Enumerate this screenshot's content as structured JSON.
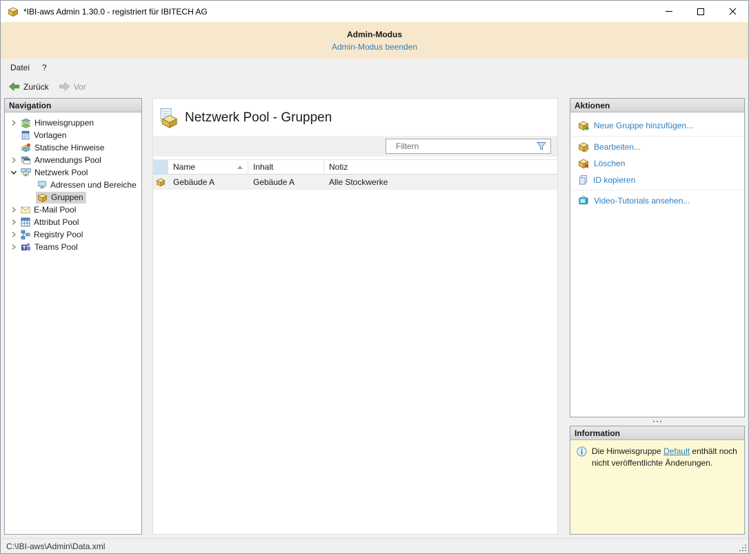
{
  "colors": {
    "accent_link": "#2e7fc2",
    "banner_bg": "#f7e7cd",
    "info_bg": "#fcf9d4",
    "selection_bg": "#d4d4d4",
    "box_gold": "#e2bb4d"
  },
  "window": {
    "title": "*IBI-aws Admin 1.30.0 - registriert für IBITECH AG"
  },
  "admin_banner": {
    "title": "Admin-Modus",
    "link": "Admin-Modus beenden"
  },
  "menu": {
    "items": [
      {
        "label": "Datei"
      },
      {
        "label": "?"
      }
    ]
  },
  "toolbar": {
    "back_label": "Zurück",
    "forward_label": "Vor"
  },
  "navigation": {
    "header": "Navigation",
    "items": [
      {
        "label": "Hinweisgruppen"
      },
      {
        "label": "Vorlagen"
      },
      {
        "label": "Statische Hinweise"
      },
      {
        "label": "Anwendungs Pool"
      },
      {
        "label": "Netzwerk Pool"
      },
      {
        "label": "Adressen und Bereiche"
      },
      {
        "label": "Gruppen"
      },
      {
        "label": "E-Mail Pool"
      },
      {
        "label": "Attribut Pool"
      },
      {
        "label": "Registry Pool"
      },
      {
        "label": "Teams Pool"
      }
    ]
  },
  "main": {
    "title": "Netzwerk Pool - Gruppen",
    "filter_placeholder": "Filtern",
    "table": {
      "columns": [
        "Name",
        "Inhalt",
        "Notiz"
      ],
      "sort_column": "Name",
      "sort_direction": "ascending",
      "rows": [
        {
          "name": "Gebäude A",
          "inhalt": "Gebäude A",
          "notiz": "Alle Stockwerke"
        }
      ]
    }
  },
  "actions": {
    "header": "Aktionen",
    "items": [
      {
        "label": "Neue Gruppe hinzufügen..."
      },
      {
        "label": "Bearbeiten..."
      },
      {
        "label": "Löschen"
      },
      {
        "label": "ID kopieren"
      },
      {
        "label": "Video-Tutorials ansehen..."
      }
    ]
  },
  "information": {
    "header": "Information",
    "text_before": "Die Hinweisgruppe ",
    "link": "Default",
    "text_after": " enthält noch nicht veröffentlichte Änderungen."
  },
  "statusbar": {
    "path": "C:\\IBI-aws\\Admin\\Data.xml"
  }
}
